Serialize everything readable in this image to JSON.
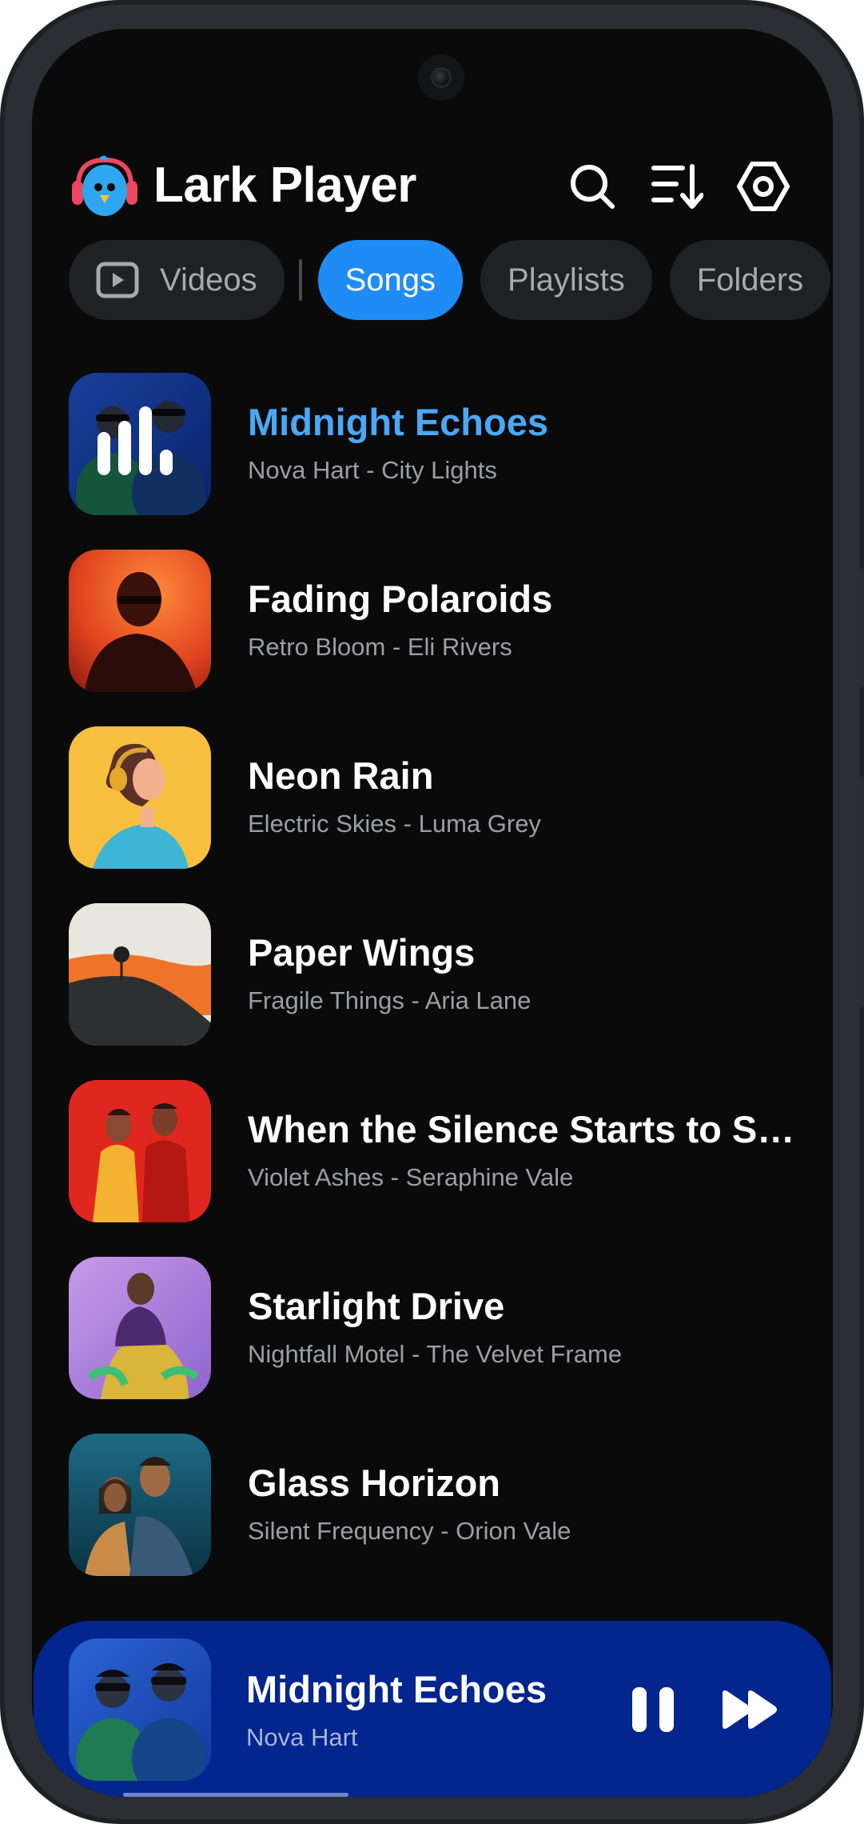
{
  "app": {
    "title": "Lark Player",
    "accent": "#1f8cf5",
    "playing_color": "#4aa8f5",
    "background": "#0a0a0b"
  },
  "header": {
    "icons": [
      "search-icon",
      "sort-icon",
      "settings-icon"
    ]
  },
  "tabs": [
    {
      "label": "Videos",
      "icon": "video-icon",
      "active": false
    },
    {
      "label": "Songs",
      "active": true
    },
    {
      "label": "Playlists",
      "active": false
    },
    {
      "label": "Folders",
      "active": false
    }
  ],
  "songs": [
    {
      "title": "Midnight Echoes",
      "subtitle": "Nova Hart - City Lights",
      "playing": true
    },
    {
      "title": "Fading Polaroids",
      "subtitle": "Retro Bloom - Eli Rivers",
      "playing": false
    },
    {
      "title": "Neon Rain",
      "subtitle": "Electric Skies - Luma Grey",
      "playing": false
    },
    {
      "title": "Paper Wings",
      "subtitle": "Fragile Things - Aria Lane",
      "playing": false
    },
    {
      "title": "When the Silence Starts to Sc…",
      "subtitle": "Violet Ashes - Seraphine Vale",
      "playing": false
    },
    {
      "title": "Starlight Drive",
      "subtitle": "Nightfall Motel - The Velvet Frame",
      "playing": false
    },
    {
      "title": "Glass Horizon",
      "subtitle": "Silent Frequency - Orion Vale",
      "playing": false
    }
  ],
  "now_playing": {
    "title": "Midnight Echoes",
    "artist": "Nova Hart",
    "state": "playing",
    "progress": 0.3,
    "controls": [
      "pause-icon",
      "next-icon"
    ],
    "background": "#02258e"
  }
}
